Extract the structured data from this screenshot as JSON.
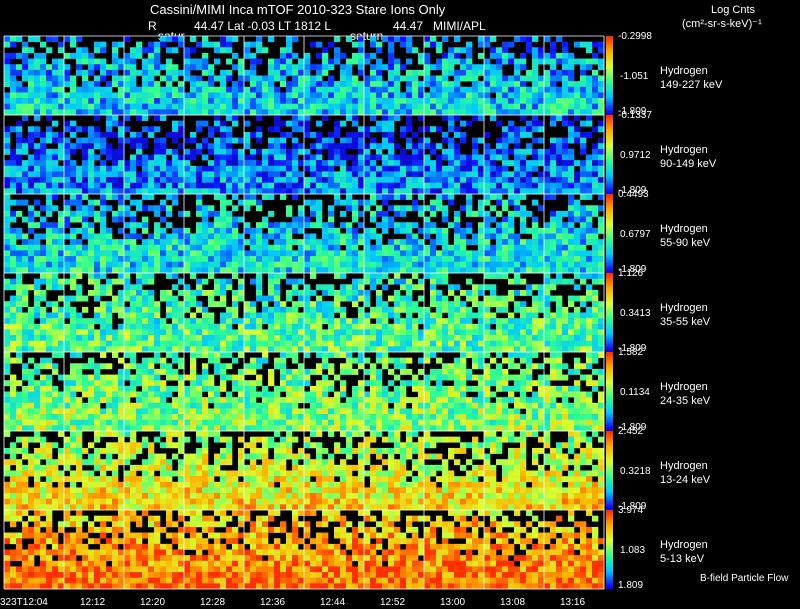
{
  "header": {
    "title": "Cassini/MIMI Inca mTOF  2010-323    Stare    Ions Only",
    "info_R": "R",
    "info_mid": "44.47  Lat -0.03  LT 1812  L",
    "info_L_val": "44.47",
    "info_org": "MIMI/APL",
    "saturn_left": "satur",
    "saturn_right": "saturn",
    "units_title": "Log Cnts",
    "units": "(cm²-sr-s-keV)⁻¹"
  },
  "footer": {
    "note": "B-field Particle Flow"
  },
  "chart_data": {
    "type": "heatmap",
    "title": "Cassini/MIMI Inca mTOF  2010-323    Stare    Ions Only",
    "x_tick_labels": [
      "323T12:04",
      "12:12",
      "12:20",
      "12:28",
      "12:36",
      "12:44",
      "12:52",
      "13:00",
      "13:08",
      "13:16"
    ],
    "frames_per_row": 10,
    "panels": [
      {
        "species": "Hydrogen",
        "energy": "149-227 keV",
        "cb_max": "-0.2998",
        "cb_mid": "-1.051",
        "cb_min": "-1.809",
        "level": 0.35
      },
      {
        "species": "Hydrogen",
        "energy": "90-149 keV",
        "cb_max": "-0.1337",
        "cb_mid": "0.9712",
        "cb_min": "-1.809",
        "level": 0.25
      },
      {
        "species": "Hydrogen",
        "energy": "55-90 keV",
        "cb_max": "0.4493",
        "cb_mid": "0.6797",
        "cb_min": "-1.809",
        "level": 0.38
      },
      {
        "species": "Hydrogen",
        "energy": "35-55 keV",
        "cb_max": "1.126",
        "cb_mid": "0.3413",
        "cb_min": "-1.809",
        "level": 0.48
      },
      {
        "species": "Hydrogen",
        "energy": "24-35 keV",
        "cb_max": "1.582",
        "cb_mid": "0.1134",
        "cb_min": "-1.809",
        "level": 0.55
      },
      {
        "species": "Hydrogen",
        "energy": "13-24 keV",
        "cb_max": "2.452",
        "cb_mid": "0.3218",
        "cb_min": "-1.809",
        "level": 0.68
      },
      {
        "species": "Hydrogen",
        "energy": "5-13 keV",
        "cb_max": "3.974",
        "cb_mid": "1.083",
        "cb_min": "1.809",
        "level": 0.85
      }
    ],
    "colorscale": [
      "#000000",
      "#1010ff",
      "#00c8ff",
      "#30ff90",
      "#d8ff30",
      "#ffb000",
      "#ff3000"
    ],
    "grid": true
  }
}
